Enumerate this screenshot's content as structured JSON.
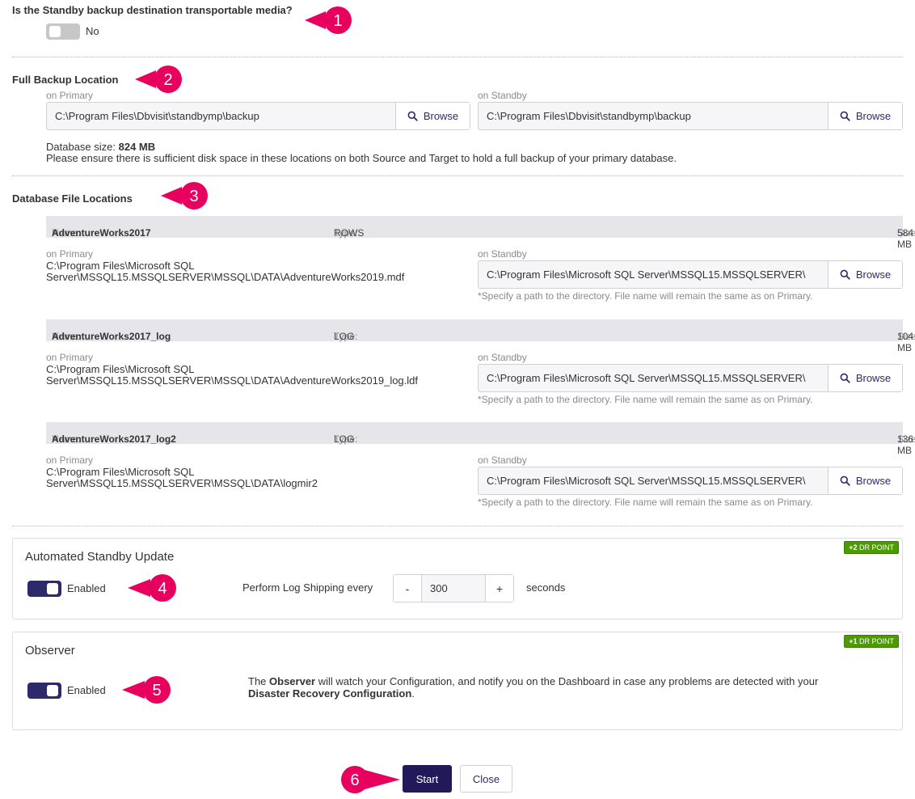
{
  "transportable": {
    "question": "Is the Standby backup destination transportable media?",
    "state_label": "No"
  },
  "full_backup": {
    "title": "Full Backup Location",
    "primary_label": "on Primary",
    "primary_path": "C:\\Program Files\\Dbvisit\\standbymp\\backup",
    "standby_label": "on Standby",
    "standby_path": "C:\\Program Files\\Dbvisit\\standbymp\\backup",
    "browse_label": "Browse",
    "db_size_label": "Database size:",
    "db_size_value": "824 MB",
    "note": "Please ensure there is sufficient disk space in these locations on both Source and Target to hold a full backup of your primary database."
  },
  "db_files": {
    "title": "Database File Locations",
    "name_label": "Name:",
    "type_label": "Type:",
    "size_label": "Size:",
    "primary_label": "on Primary",
    "standby_label": "on Standby",
    "browse_label": "Browse",
    "hint": "*Specify a path to the directory. File name will remain the same as on Primary.",
    "files": [
      {
        "name": "AdventureWorks2017",
        "type": "ROWS",
        "size": "584 MB",
        "primary_line1": "C:\\Program Files\\Microsoft SQL",
        "primary_line2": "Server\\MSSQL15.MSSQLSERVER\\MSSQL\\DATA\\AdventureWorks2019.mdf",
        "standby_path": "C:\\Program Files\\Microsoft SQL Server\\MSSQL15.MSSQLSERVER\\"
      },
      {
        "name": "AdventureWorks2017_log",
        "type": "LOG",
        "size": "104 MB",
        "primary_line1": "C:\\Program Files\\Microsoft SQL",
        "primary_line2": "Server\\MSSQL15.MSSQLSERVER\\MSSQL\\DATA\\AdventureWorks2019_log.ldf",
        "standby_path": "C:\\Program Files\\Microsoft SQL Server\\MSSQL15.MSSQLSERVER\\"
      },
      {
        "name": "AdventureWorks2017_log2",
        "type": "LOG",
        "size": "136 MB",
        "primary_line1": "C:\\Program Files\\Microsoft SQL",
        "primary_line2": "Server\\MSSQL15.MSSQLSERVER\\MSSQL\\DATA\\logmir2",
        "standby_path": "C:\\Program Files\\Microsoft SQL Server\\MSSQL15.MSSQLSERVER\\"
      }
    ]
  },
  "auto_update": {
    "title": "Automated Standby Update",
    "badge_points": "+2",
    "badge_text": "DR POINT",
    "toggle_label": "Enabled",
    "interval_label": "Perform Log Shipping every",
    "minus": "-",
    "value": "300",
    "plus": "+",
    "unit": "seconds"
  },
  "observer": {
    "title": "Observer",
    "badge_points": "+1",
    "badge_text": "DR POINT",
    "toggle_label": "Enabled",
    "desc_pre": "The ",
    "desc_bold1": "Observer",
    "desc_mid": " will watch your Configuration, and notify you on the Dashboard in case any problems are detected with your",
    "desc_bold2": "Disaster Recovery Configuration",
    "desc_post": "."
  },
  "actions": {
    "start_label": "Start",
    "close_label": "Close"
  },
  "callouts": [
    "1",
    "2",
    "3",
    "4",
    "5",
    "6"
  ],
  "colors": {
    "callout": "#e8005e",
    "primary_button": "#22195a",
    "toggle_on": "#2d2a6b",
    "badge": "#4e9a06"
  }
}
